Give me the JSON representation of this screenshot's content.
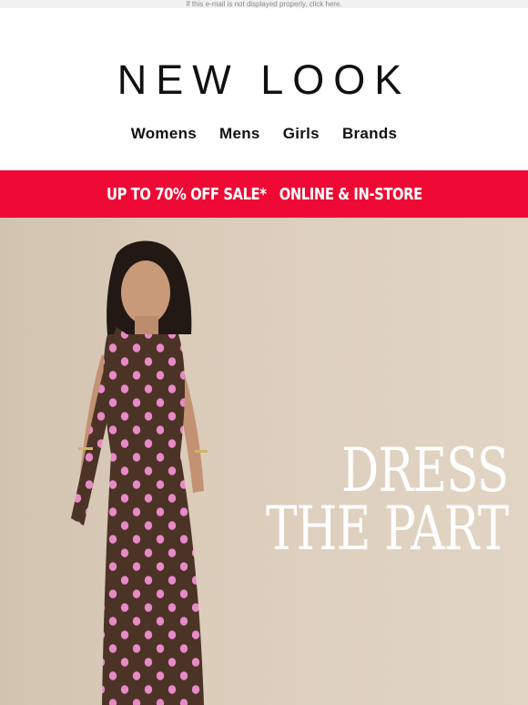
{
  "preheader": {
    "text": "If this e-mail is not displayed properly, click here."
  },
  "brand": {
    "logo": "NEW LOOK"
  },
  "nav": {
    "items": [
      "Womens",
      "Mens",
      "Girls",
      "Brands"
    ]
  },
  "promo_banner": {
    "text": "UP TO 70% OFF SALE*   ONLINE & IN-STORE",
    "background": "#ee0a34"
  },
  "hero": {
    "headline_line1": "DRESS",
    "headline_line2": "THE PART",
    "background": "#d9cbb9",
    "image": "model-in-polka-dot-dress"
  }
}
